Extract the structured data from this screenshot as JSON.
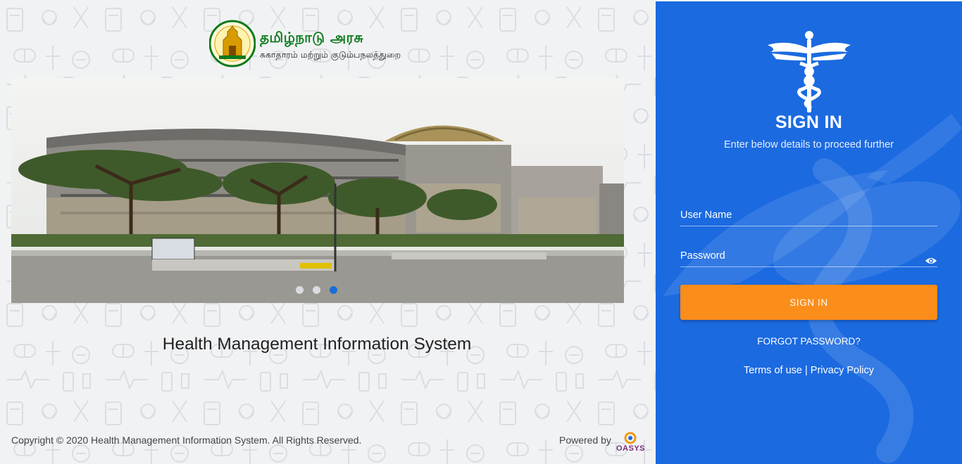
{
  "brand": {
    "title": "தமிழ்நாடு அரசு",
    "subtitle": "சுகாதாரம் மற்றும் குடும்பநலத்துறை"
  },
  "carousel": {
    "slide_count": 3,
    "active_index": 2
  },
  "main": {
    "system_title": "Health Management Information System"
  },
  "footer": {
    "copyright": "Copyright © 2020 Health Management Information System. All Rights Reserved.",
    "powered_by": "Powered by",
    "vendor": "OASYS"
  },
  "signin": {
    "title": "SIGN IN",
    "subtitle": "Enter below details to proceed further",
    "username_placeholder": "User Name",
    "password_placeholder": "Password",
    "button_label": "SIGN IN",
    "forgot_label": "FORGOT PASSWORD?",
    "terms_label": "Terms of use",
    "separator": " | ",
    "privacy_label": "Privacy Policy"
  },
  "colors": {
    "panel_blue": "#1b6ae0",
    "button_orange": "#fb8d1a",
    "brand_green": "#0a7a1a"
  },
  "icons": [
    "emblem-icon",
    "caduceus-icon",
    "eye-icon",
    "oasys-logo"
  ]
}
